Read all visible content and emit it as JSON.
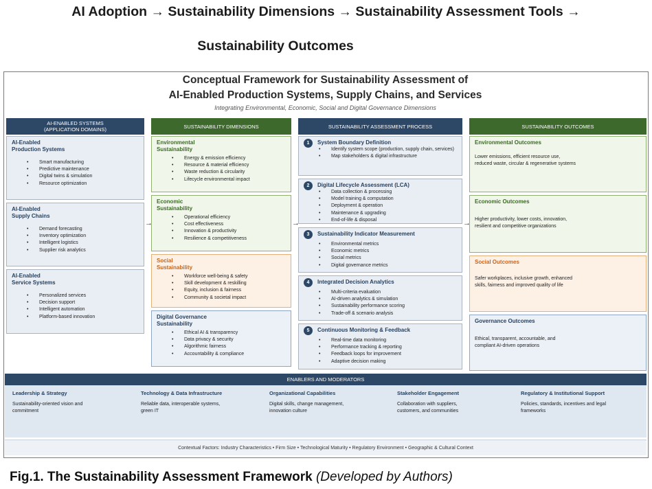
{
  "headline": {
    "line1": "AI Adoption → Sustainability Dimensions → Sustainability Assessment Tools →",
    "line2": "Sustainability Outcomes"
  },
  "framework": {
    "title_line1": "Conceptual Framework for Sustainability Assessment of",
    "title_line2": "AI-Enabled Production Systems, Supply Chains, and Services",
    "subtitle": "Integrating Environmental, Economic, Social and Digital Governance Dimensions"
  },
  "columns": {
    "systems": {
      "header_line1": "AI-ENABLED SYSTEMS",
      "header_line2": "(APPLICATION DOMAINS)",
      "items": [
        {
          "title_line1": "AI-Enabled",
          "title_line2": "Production Systems",
          "bullets": [
            "Smart manufacturing",
            "Predictive maintenance",
            "Digital twins & simulation",
            "Resource optimization"
          ]
        },
        {
          "title_line1": "AI-Enabled",
          "title_line2": "Supply Chains",
          "bullets": [
            "Demand forecasting",
            "Inventory optimization",
            "Intelligent logistics",
            "Supplier risk analytics"
          ]
        },
        {
          "title_line1": "AI-Enabled",
          "title_line2": "Service Systems",
          "bullets": [
            "Personalized services",
            "Decision support",
            "Intelligent automation",
            "Platform-based innovation"
          ]
        }
      ]
    },
    "dimensions": {
      "header": "SUSTAINABILITY DIMENSIONS",
      "items": [
        {
          "title_line1": "Environmental",
          "title_line2": "Sustainability",
          "bullets": [
            "Energy & emission efficiency",
            "Resource & material efficiency",
            "Waste reduction & circularity",
            "Lifecycle environmental impact"
          ]
        },
        {
          "title_line1": "Economic",
          "title_line2": "Sustainability",
          "bullets": [
            "Operational efficiency",
            "Cost effectiveness",
            "Innovation & productivity",
            "Resilience & competitiveness"
          ]
        },
        {
          "title_line1": "Social",
          "title_line2": "Sustainability",
          "bullets": [
            "Workforce well-being & safety",
            "Skill development & reskilling",
            "Equity, inclusion & fairness",
            "Community & societal impact"
          ]
        },
        {
          "title_line1": "Digital Governance",
          "title_line2": "Sustainability",
          "bullets": [
            "Ethical AI & transparency",
            "Data privacy & security",
            "Algorithmic fairness",
            "Accountability & compliance"
          ]
        }
      ]
    },
    "process": {
      "header": "SUSTAINABILITY ASSESSMENT PROCESS",
      "steps": [
        {
          "num": "1",
          "title": "System Boundary Definition",
          "bullets": [
            "Identify system scope (production, supply chain, services)",
            "Map stakeholders & digital infrastructure"
          ]
        },
        {
          "num": "2",
          "title": "Digital Lifecycle Assessment (LCA)",
          "bullets": [
            "Data collection & processing",
            "Model training & computation",
            "Deployment & operation",
            "Maintenance & upgrading",
            "End-of-life & disposal"
          ]
        },
        {
          "num": "3",
          "title": "Sustainability Indicator Measurement",
          "bullets": [
            "Environmental metrics",
            "Economic metrics",
            "Social metrics",
            "Digital governance metrics"
          ]
        },
        {
          "num": "4",
          "title": "Integrated Decision Analytics",
          "bullets": [
            "Multi-criteria evaluation",
            "AI-driven analytics & simulation",
            "Sustainability performance scoring",
            "Trade-off & scenario analysis"
          ]
        },
        {
          "num": "5",
          "title": "Continuous Monitoring & Feedback",
          "bullets": [
            "Real-time data monitoring",
            "Performance tracking & reporting",
            "Feedback loops for improvement",
            "Adaptive decision making"
          ]
        }
      ]
    },
    "outcomes": {
      "header": "SUSTAINABILITY OUTCOMES",
      "items": [
        {
          "title": "Environmental Outcomes",
          "line1": "Lower emissions, efficient resource use,",
          "line2": "reduced waste, circular & regenerative systems"
        },
        {
          "title": "Economic Outcomes",
          "line1": "Higher productivity, lower costs, innovation,",
          "line2": "resilient and competitive organizations"
        },
        {
          "title": "Social Outcomes",
          "line1": "Safer workplaces, inclusive growth, enhanced",
          "line2": "skills, fairness and improved quality of life"
        },
        {
          "title": "Governance Outcomes",
          "line1": "Ethical, transparent, accountable, and",
          "line2": "compliant AI-driven operations"
        }
      ]
    }
  },
  "enablers": {
    "header": "ENABLERS AND MODERATORS",
    "items": [
      {
        "title": "Leadership & Strategy",
        "line1": "Sustainability-oriented vision and",
        "line2": "commitment"
      },
      {
        "title": "Technology & Data Infrastructure",
        "line1": "Reliable data, interoperable systems,",
        "line2": "green IT"
      },
      {
        "title": "Organizational Capabilities",
        "line1": "Digital skills, change management,",
        "line2": "innovation culture"
      },
      {
        "title": "Stakeholder Engagement",
        "line1": "Collaboration with suppliers,",
        "line2": "customers, and communities"
      },
      {
        "title": "Regulatory & Institutional Support",
        "line1": "Policies, standards, incentives and legal",
        "line2": "frameworks"
      }
    ],
    "context": "Contextual Factors: Industry Characteristics • Firm Size • Technological Maturity • Regulatory Environment • Geographic & Cultural Context"
  },
  "caption": {
    "label": "Fig.1. The Sustainability Assessment Framework",
    "note": "(Developed by Authors)"
  },
  "arrow_glyph": "→"
}
